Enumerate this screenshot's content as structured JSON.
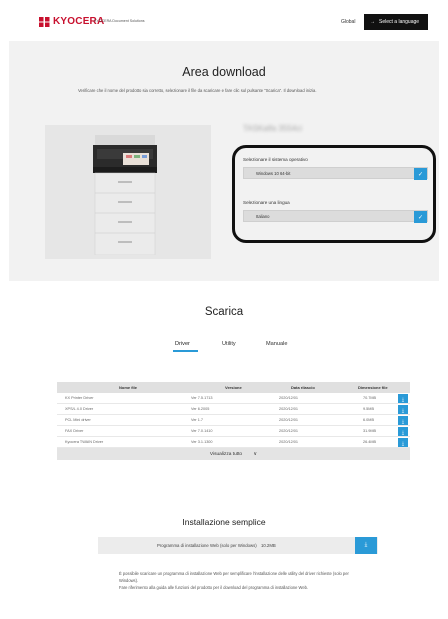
{
  "header": {
    "logo_text": "KYOCERA",
    "tagline": "KYOCERA Document Solutions",
    "global_link": "Global",
    "language_button": "Select a language",
    "language_arrow": "→"
  },
  "hero": {
    "title": "Area download",
    "description": "Verificare che il nome del prodotto sia corretto, selezionare il file da scaricare e fare clic sul pulsante \"Scarica\". Il download inizia.",
    "product_name": "TASKalfa 3554ci",
    "os_label": "Selezionare il sistema operativo",
    "os_value": "Windows 10 64-bit",
    "language_label": "Selezionare una lingua",
    "language_value": "Italiano",
    "caret": "✓"
  },
  "download": {
    "title": "Scarica",
    "tabs": [
      {
        "label": "Driver",
        "active": true
      },
      {
        "label": "Utility",
        "active": false
      },
      {
        "label": "Manuale",
        "active": false
      }
    ],
    "columns": [
      "Nome file",
      "Versione",
      "Data rilascio",
      "Dimensione file"
    ],
    "rows": [
      {
        "name": "KX Printer Driver",
        "version": "Ver 7.5.1713",
        "date": "2020/12/01",
        "size": "70.7MB"
      },
      {
        "name": "XPS/L 4.0 Driver",
        "version": "Ver 6.2005",
        "date": "2020/12/01",
        "size": "9.5MB"
      },
      {
        "name": "PCL Mini driver",
        "version": "Ver 1.7",
        "date": "2020/12/01",
        "size": "6.0MB"
      },
      {
        "name": "FAX Driver",
        "version": "Ver 7.0.1410",
        "date": "2020/12/01",
        "size": "31.9MB"
      },
      {
        "name": "Kyocera TWAIN Driver",
        "version": "Ver 3.1.1300",
        "date": "2020/12/01",
        "size": "26.4MB"
      }
    ],
    "download_icon": "⤓",
    "show_all": "Visualizza tutto",
    "show_all_chevron": "∨"
  },
  "install": {
    "title": "Installazione semplice",
    "program_label": "Programma di installazione Web (solo per Windows)",
    "program_size": "10.2MB",
    "download_icon": "⤓",
    "notes": [
      "È possibile scaricare un programma di installazione Web per semplificare l'installazione delle utility del driver richieste (solo per Windows).",
      "Fare riferimento alla guida alle funzioni del prodotto per il download del programma di installazione Web."
    ]
  },
  "colors": {
    "accent": "#2a9ad7",
    "brand": "#c8102e",
    "hero_bg": "#f2f2f2",
    "highlight_border": "#111111"
  }
}
